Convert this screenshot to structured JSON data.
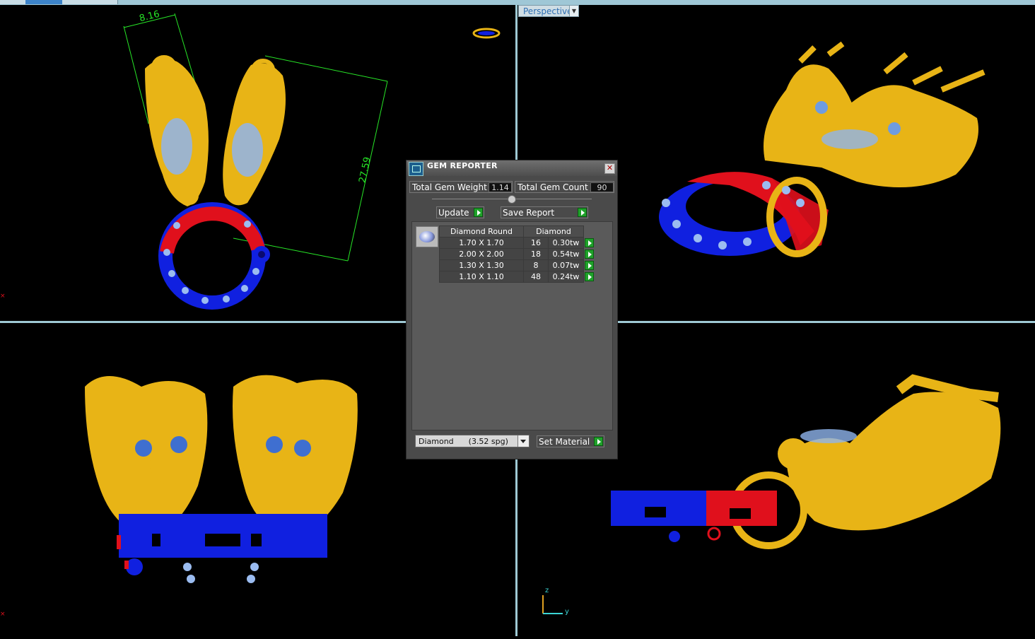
{
  "viewport": {
    "perspective_label": "Perspective",
    "dimension_width": "8.16",
    "dimension_length": "27.59",
    "axis_z": "z",
    "axis_y": "y"
  },
  "gem_reporter": {
    "title": "GEM REPORTER",
    "total_gem_weight_label": "Total Gem Weight",
    "total_gem_weight_value": "1.14",
    "total_gem_count_label": "Total Gem Count",
    "total_gem_count_value": "90",
    "update_label": "Update",
    "save_report_label": "Save Report",
    "columns": [
      "Diamond Round",
      "Diamond"
    ],
    "rows": [
      {
        "size": "1.70 X 1.70",
        "count": "16",
        "weight": "0.30tw"
      },
      {
        "size": "2.00 X 2.00",
        "count": "18",
        "weight": "0.54tw"
      },
      {
        "size": "1.30 X 1.30",
        "count": "8",
        "weight": "0.07tw"
      },
      {
        "size": "1.10 X 1.10",
        "count": "48",
        "weight": "0.24tw"
      }
    ],
    "material_selected": "Diamond      (3.52 spg)",
    "set_material_label": "Set Material"
  },
  "colors": {
    "gold": "#e8b416",
    "gem_blue": "#8fb4ec",
    "red": "#e0101c",
    "blue": "#1020e0",
    "dimension_green": "#27e627"
  }
}
